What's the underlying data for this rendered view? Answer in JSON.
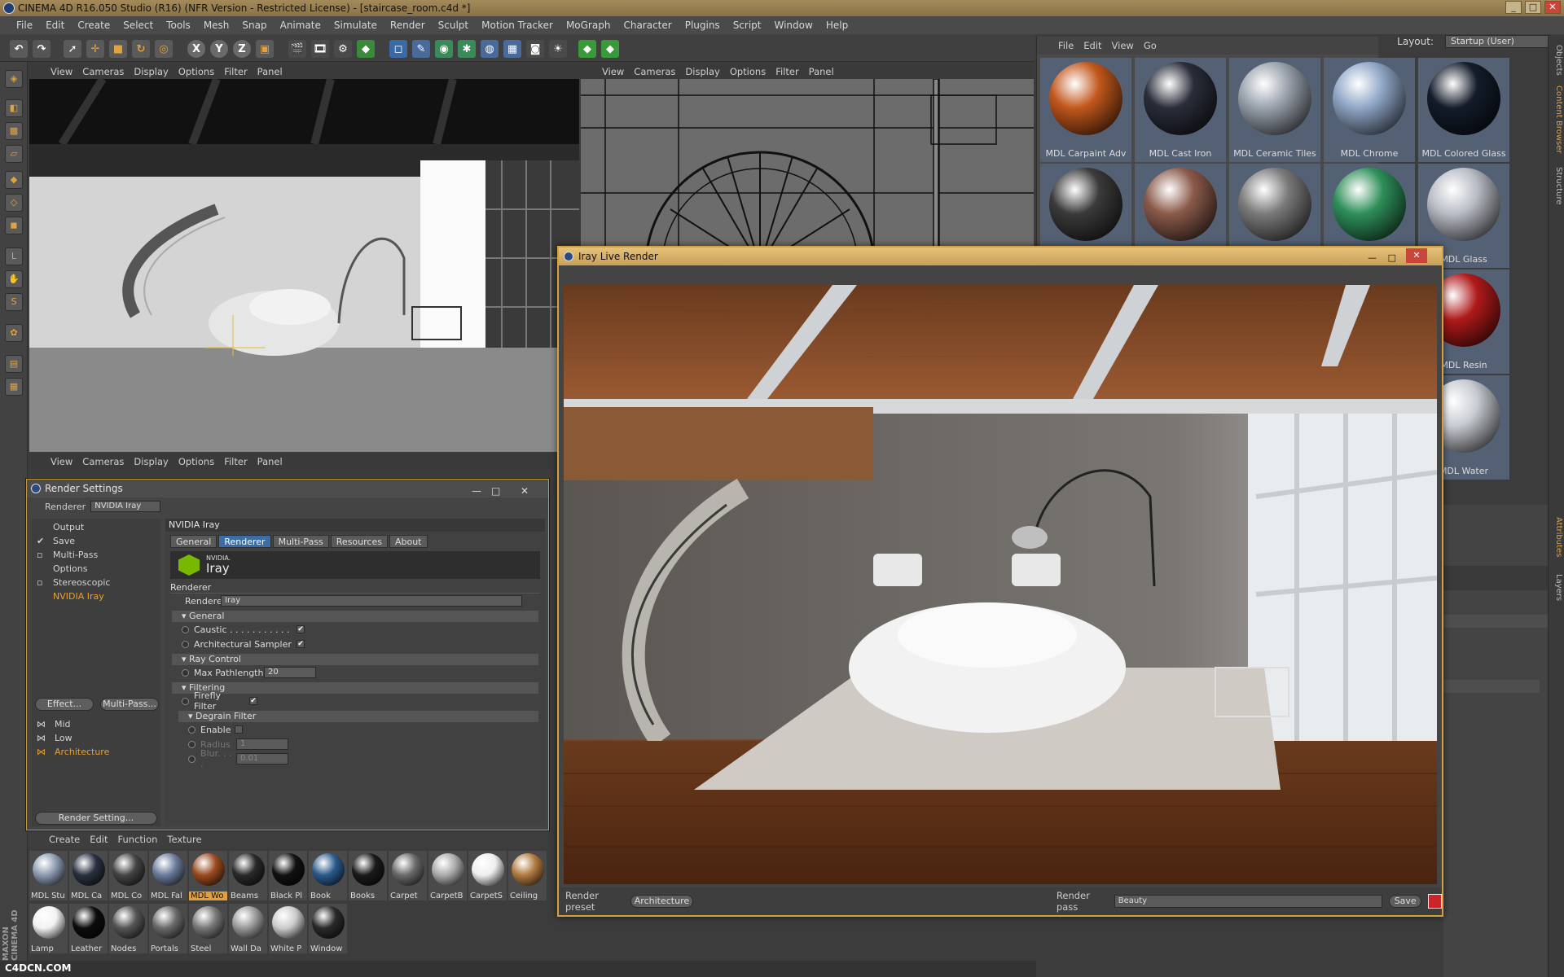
{
  "app": {
    "title": "CINEMA 4D R16.050 Studio (R16) (NFR Version - Restricted License) - [staircase_room.c4d *]",
    "menu": [
      "File",
      "Edit",
      "Create",
      "Select",
      "Tools",
      "Mesh",
      "Snap",
      "Animate",
      "Simulate",
      "Render",
      "Sculpt",
      "Motion Tracker",
      "MoGraph",
      "Character",
      "Plugins",
      "Script",
      "Window",
      "Help"
    ],
    "layout_label": "Layout:",
    "layout_value": "Startup (User)"
  },
  "viewport_menu": [
    "View",
    "Cameras",
    "Display",
    "Options",
    "Filter",
    "Panel"
  ],
  "content_browser": {
    "menu": [
      "File",
      "Edit",
      "View",
      "Go"
    ],
    "items": [
      {
        "label": "MDL Carpaint Adv",
        "color": "#c2571c"
      },
      {
        "label": "MDL Cast Iron",
        "color": "#2a2d3a"
      },
      {
        "label": "MDL Ceramic Tiles",
        "color": "#9aa2ad"
      },
      {
        "label": "MDL Chrome",
        "color": "#8fa6c6"
      },
      {
        "label": "MDL Colored Glass",
        "color": "#141c2a"
      },
      {
        "label": "",
        "color": "#3a3a3a"
      },
      {
        "label": "",
        "color": "#8a5a4a"
      },
      {
        "label": "",
        "color": "#7a7a7a"
      },
      {
        "label": "",
        "color": "#2e8f5a"
      },
      {
        "label": "MDL Glass",
        "color": "#b8bcc4"
      },
      {
        "label": "MDL Resin",
        "color": "#b01a1a"
      },
      {
        "label": "MDL Water",
        "color": "#c8ccd2"
      }
    ],
    "side_tabs": [
      "Objects",
      "Content Browser",
      "Structure"
    ],
    "attr_tabs": [
      "Attributes",
      "Layers"
    ]
  },
  "render_settings": {
    "title": "Render Settings",
    "renderer_label": "Renderer",
    "renderer_value": "NVIDIA Iray",
    "tree": [
      "Output",
      "Save",
      "Multi-Pass",
      "Options",
      "Stereoscopic",
      "NVIDIA Iray"
    ],
    "effect_btn": "Effect...",
    "multipass_btn": "Multi-Pass...",
    "presets": [
      "Mid",
      "Low",
      "Architecture"
    ],
    "render_setting_btn": "Render Setting...",
    "panel_title": "NVIDIA Iray",
    "tabs": [
      "General",
      "Renderer",
      "Multi-Pass",
      "Resources",
      "About"
    ],
    "logo_small": "NVIDIA.",
    "logo_big": "Iray",
    "section_renderer": "Renderer",
    "renderer_field_label": "Renderer",
    "renderer_field_value": "Iray",
    "general": "General",
    "caustic": "Caustic . . . . . . . . . . .",
    "arch_sampler": "Architectural Sampler",
    "ray_control": "Ray Control",
    "max_path": "Max Pathlength",
    "max_path_value": "20",
    "filtering": "Filtering",
    "firefly": "Firefly Filter",
    "degrain": "Degrain Filter",
    "enable": "Enable",
    "radius": "Radius",
    "radius_value": "1",
    "blur": "Blur. . . .",
    "blur_value": "0.01"
  },
  "material_manager": {
    "menu": [
      "Create",
      "Edit",
      "Function",
      "Texture"
    ],
    "materials": [
      {
        "label": "MDL Stu",
        "color": "#8a9ab0"
      },
      {
        "label": "MDL Ca",
        "color": "#2a3040"
      },
      {
        "label": "MDL Co",
        "color": "#444"
      },
      {
        "label": "MDL Fal",
        "color": "#6a7a9a"
      },
      {
        "label": "MDL Wo",
        "color": "#9a4a20"
      },
      {
        "label": "Beams",
        "color": "#2a2a2a"
      },
      {
        "label": "Black Pl",
        "color": "#111"
      },
      {
        "label": "Book",
        "color": "#2a5a8a"
      },
      {
        "label": "Books",
        "color": "#1a1a1a"
      },
      {
        "label": "Carpet",
        "color": "#6a6a6a"
      },
      {
        "label": "CarpetB",
        "color": "#aaa"
      },
      {
        "label": "CarpetS",
        "color": "#eee"
      },
      {
        "label": "Ceiling",
        "color": "#b07a40"
      },
      {
        "label": "Lamp",
        "color": "#f2f2f2"
      },
      {
        "label": "Leather",
        "color": "#0c0c0c"
      },
      {
        "label": "Nodes",
        "color": "#555"
      },
      {
        "label": "Portals",
        "color": "#6a6a6a"
      },
      {
        "label": "Steel",
        "color": "#777"
      },
      {
        "label": "Wall Da",
        "color": "#999"
      },
      {
        "label": "White P",
        "color": "#ccc"
      },
      {
        "label": "Window",
        "color": "#2a2a2a"
      }
    ]
  },
  "iray_live": {
    "title": "Iray Live Render",
    "render_preset_label": "Render preset",
    "render_preset_value": "Architecture",
    "render_pass_label": "Render pass",
    "render_pass_value": "Beauty",
    "save": "Save"
  },
  "branding": {
    "maxon": "MAXON",
    "cinema": "CINEMA 4D",
    "watermark": "C4DCN.COM"
  }
}
